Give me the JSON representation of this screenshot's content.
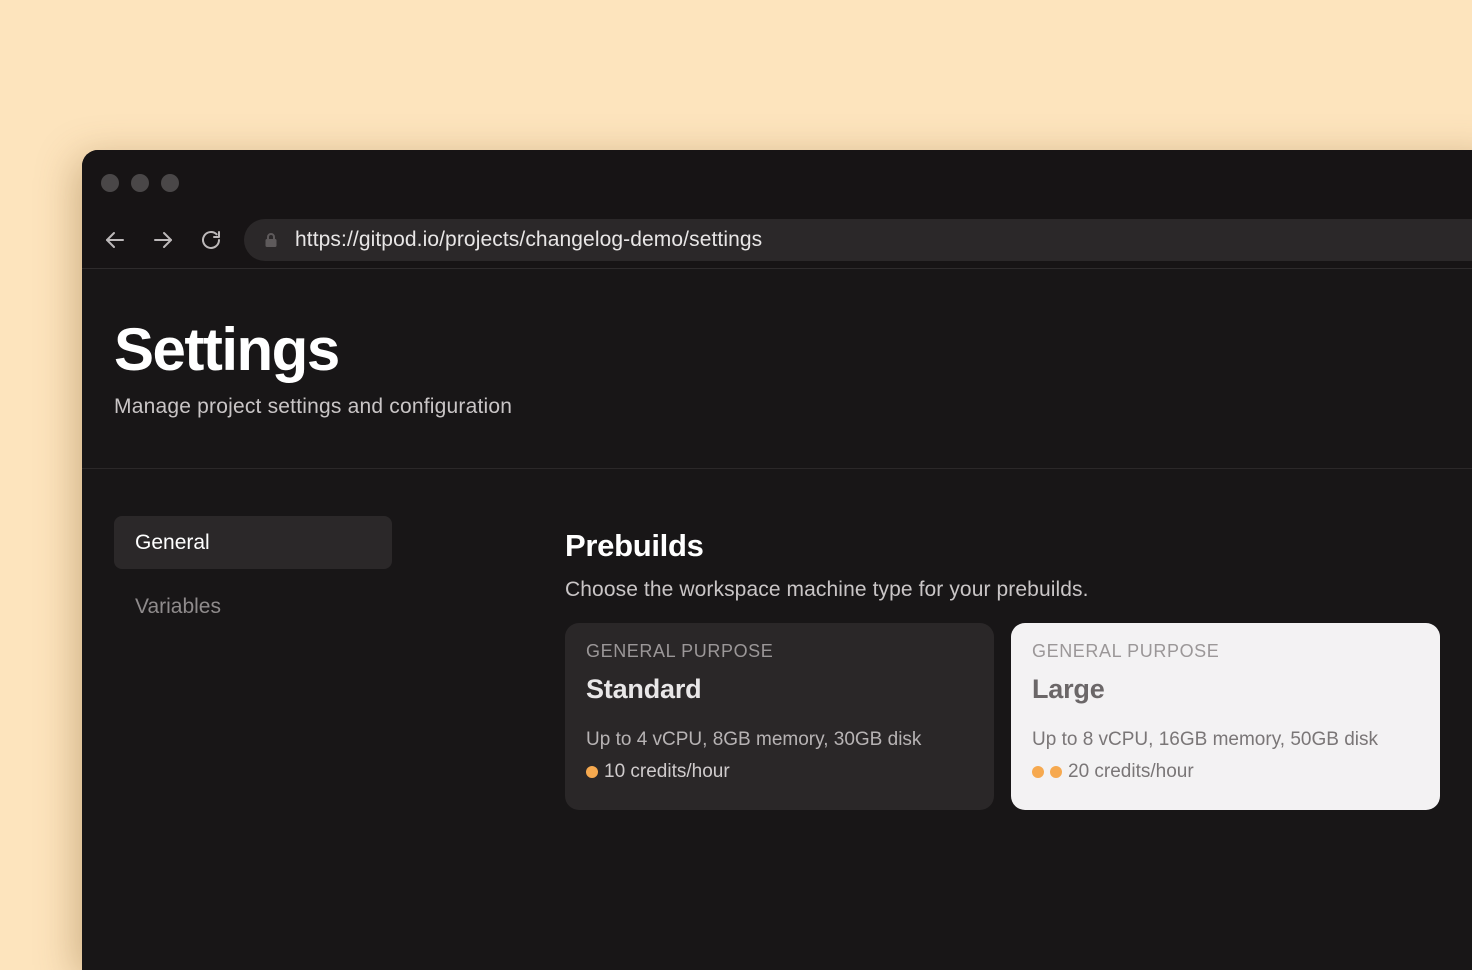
{
  "browser": {
    "url": "https://gitpod.io/projects/changelog-demo/settings",
    "back_icon": "arrow-left-icon",
    "forward_icon": "arrow-right-icon",
    "reload_icon": "reload-icon",
    "lock_icon": "lock-icon"
  },
  "header": {
    "title": "Settings",
    "subtitle": "Manage project settings and configuration"
  },
  "sidebar": {
    "items": [
      {
        "label": "General",
        "active": true
      },
      {
        "label": "Variables",
        "active": false
      }
    ]
  },
  "prebuilds": {
    "title": "Prebuilds",
    "description": "Choose the workspace machine type for your prebuilds.",
    "options": [
      {
        "category": "GENERAL PURPOSE",
        "name": "Standard",
        "specs": "Up to 4 vCPU, 8GB memory, 30GB disk",
        "credits": "10 credits/hour",
        "credit_dots": 1,
        "selected": false
      },
      {
        "category": "GENERAL PURPOSE",
        "name": "Large",
        "specs": "Up to 8 vCPU, 16GB memory, 50GB disk",
        "credits": "20 credits/hour",
        "credit_dots": 2,
        "selected": true
      }
    ]
  },
  "colors": {
    "background": "#fde4bd",
    "window": "#181617",
    "accent_dot": "#f6a94f",
    "selected_card": "#f3f2f3"
  }
}
